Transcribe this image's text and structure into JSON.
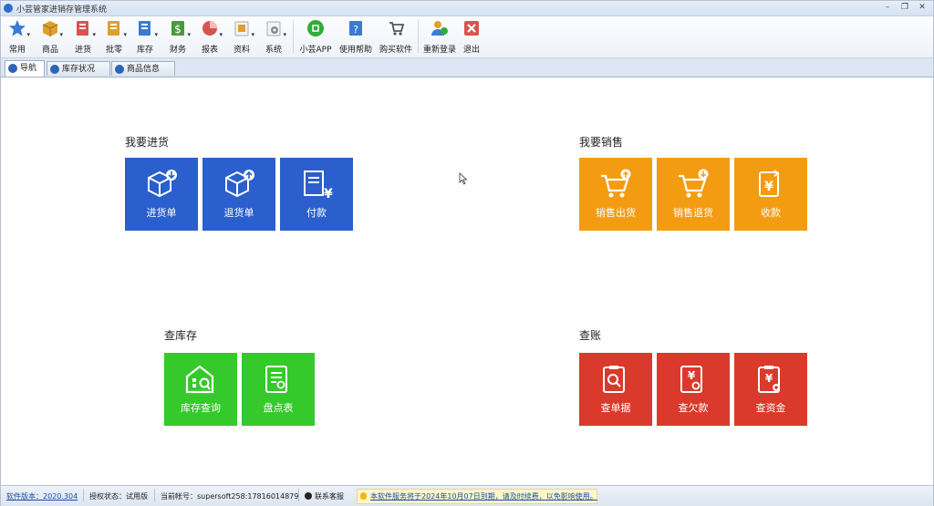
{
  "window": {
    "title": "小芸管家进销存管理系统"
  },
  "toolbar": {
    "items": [
      {
        "label": "常用",
        "icon": "star-icon",
        "color": "#3a7bd5",
        "dropdown": true
      },
      {
        "label": "商品",
        "icon": "box-icon",
        "color": "#e0a030",
        "dropdown": true
      },
      {
        "label": "进货",
        "icon": "purchase-icon",
        "color": "#d9534f",
        "dropdown": true
      },
      {
        "label": "批零",
        "icon": "retail-icon",
        "color": "#e0a030",
        "dropdown": true
      },
      {
        "label": "库存",
        "icon": "inventory-icon",
        "color": "#3a7bd5",
        "dropdown": true
      },
      {
        "label": "财务",
        "icon": "finance-icon",
        "color": "#4a9a3a",
        "dropdown": true
      },
      {
        "label": "报表",
        "icon": "report-icon",
        "color": "#d9534f",
        "dropdown": true
      },
      {
        "label": "资料",
        "icon": "data-icon",
        "color": "#e0a030",
        "dropdown": true
      },
      {
        "label": "系统",
        "icon": "settings-icon",
        "color": "#7f8c9a",
        "dropdown": true
      },
      {
        "label": "小芸APP",
        "icon": "app-icon",
        "color": "#2fae3a",
        "dropdown": false
      },
      {
        "label": "使用帮助",
        "icon": "help-icon",
        "color": "#3a7bd5",
        "dropdown": false
      },
      {
        "label": "购买软件",
        "icon": "cart-icon",
        "color": "#555555",
        "dropdown": false
      },
      {
        "label": "重新登录",
        "icon": "relogin-icon",
        "color": "#e0a030",
        "dropdown": false
      },
      {
        "label": "退出",
        "icon": "exit-icon",
        "color": "#d9534f",
        "dropdown": false
      }
    ]
  },
  "tabs": [
    {
      "label": "导航",
      "active": true
    },
    {
      "label": "库存状况",
      "active": false
    },
    {
      "label": "商品信息",
      "active": false
    }
  ],
  "groups": {
    "purchase": {
      "title": "我要进货",
      "color": "#2b5fcd",
      "tiles": [
        {
          "label": "进货单",
          "icon": "box-in-icon"
        },
        {
          "label": "退货单",
          "icon": "box-return-icon"
        },
        {
          "label": "付款",
          "icon": "payment-icon"
        }
      ]
    },
    "sales": {
      "title": "我要销售",
      "color": "#f39c12",
      "tiles": [
        {
          "label": "销售出货",
          "icon": "cart-out-icon"
        },
        {
          "label": "销售退货",
          "icon": "cart-return-icon"
        },
        {
          "label": "收款",
          "icon": "receive-payment-icon"
        }
      ]
    },
    "stock": {
      "title": "查库存",
      "color": "#36c92c",
      "tiles": [
        {
          "label": "库存查询",
          "icon": "warehouse-search-icon"
        },
        {
          "label": "盘点表",
          "icon": "checklist-icon"
        }
      ]
    },
    "accounts": {
      "title": "查账",
      "color": "#d93a2b",
      "tiles": [
        {
          "label": "查单据",
          "icon": "document-search-icon"
        },
        {
          "label": "查欠款",
          "icon": "debt-search-icon"
        },
        {
          "label": "查资金",
          "icon": "funds-search-icon"
        }
      ]
    }
  },
  "status": {
    "version": "软件版本：2020.304",
    "license": "授权状态：试用版",
    "account": "当前帐号：supersoft258:17816014879",
    "support": "联系客服",
    "notice": "本软件服务将于2024年10月07日到期，请及时续费，以免影响使用。"
  }
}
